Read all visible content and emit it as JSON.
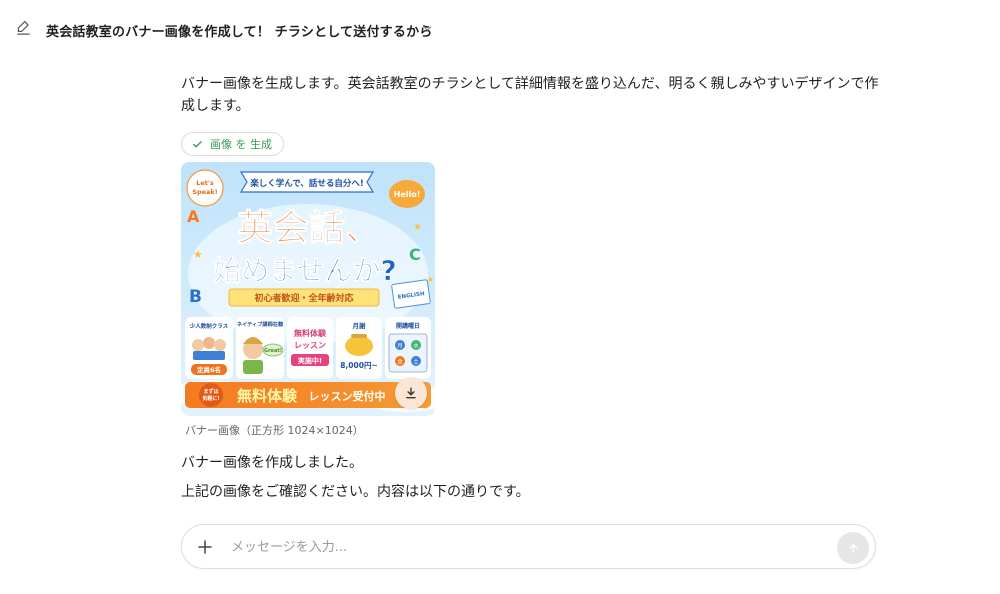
{
  "header": {
    "title": "英会話教室のバナー画像を作成して！ チラシとして送付するから"
  },
  "chat": {
    "message_1": "バナー画像を生成します。英会話教室のチラシとして詳細情報を盛り込んだ、明るく親しみやすいデザインで作成します。",
    "tool_label": "画像 を 生成",
    "image_caption": "バナー画像（正方形 1024×1024）",
    "message_2": "バナー画像を作成しました。",
    "message_3": "上記の画像をご確認ください。内容は以下の通りです。"
  },
  "banner": {
    "top_ribbon": "楽しく学んで、話せる自分へ!",
    "bubble_left": "Let's Speak!",
    "bubble_right": "Hello!",
    "headline_1": "英会話、",
    "headline_2": "始めませんか?",
    "subline": "初心者歓迎・全年齢対応",
    "letter_a": "A",
    "letter_b": "B",
    "letter_c": "C",
    "book_label": "ENGLISH",
    "feature_1_title": "少人数制クラス",
    "feature_1_badge": "定員6名",
    "feature_2_title": "ネイティブ講師在籍",
    "feature_2_bubble": "Great!",
    "feature_3_line1": "無料体験",
    "feature_3_line2": "レッスン",
    "feature_3_badge": "実施中!",
    "feature_4_title": "月謝",
    "feature_4_price": "8,000円~",
    "feature_5_title": "開講曜日",
    "feature_5_days": [
      "月",
      "水",
      "金",
      "土"
    ],
    "cta_small": "まずは気軽に!",
    "cta_big": "無料体験",
    "cta_rest": "レッスン受付中"
  },
  "composer": {
    "placeholder": "メッセージを入力..."
  },
  "colors": {
    "accent_green": "#3c9a52",
    "banner_orange": "#f0741d",
    "banner_blue": "#1e63c7",
    "cta_bar": "#f08a2a"
  }
}
